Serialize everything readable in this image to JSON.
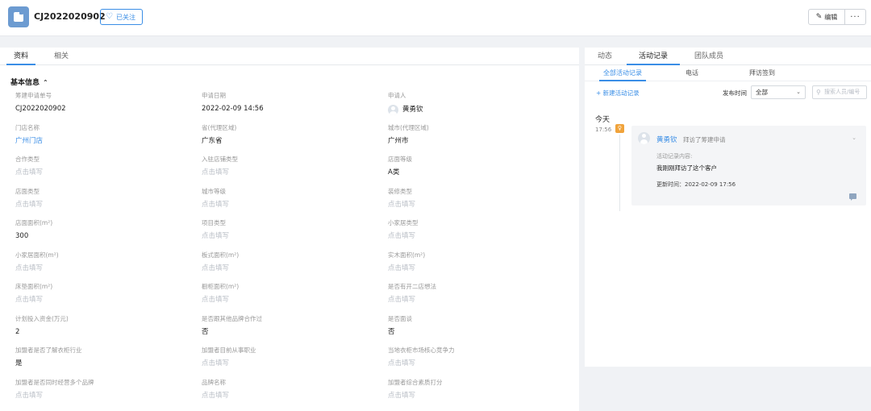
{
  "header": {
    "title": "CJ2022020902",
    "follow_label": "已关注",
    "edit_label": "编辑",
    "more_label": "···"
  },
  "left_tabs": [
    "资料",
    "相关"
  ],
  "section_title": "基本信息",
  "fields": [
    {
      "label": "筹建申请单号",
      "value": "CJ2022020902",
      "kind": "text"
    },
    {
      "label": "申请日期",
      "value": "2022-02-09 14:56",
      "kind": "text"
    },
    {
      "label": "申请人",
      "value": "黄勇钦",
      "kind": "user"
    },
    {
      "label": "门店名称",
      "value": "广州门店",
      "kind": "link"
    },
    {
      "label": "省(代理区域)",
      "value": "广东省",
      "kind": "text"
    },
    {
      "label": "城市(代理区域)",
      "value": "广州市",
      "kind": "text"
    },
    {
      "label": "合作类型",
      "value": "点击填写",
      "kind": "placeholder"
    },
    {
      "label": "入驻店铺类型",
      "value": "点击填写",
      "kind": "placeholder"
    },
    {
      "label": "店面等级",
      "value": "A类",
      "kind": "text"
    },
    {
      "label": "店面类型",
      "value": "点击填写",
      "kind": "placeholder"
    },
    {
      "label": "城市等级",
      "value": "点击填写",
      "kind": "placeholder"
    },
    {
      "label": "装修类型",
      "value": "点击填写",
      "kind": "placeholder"
    },
    {
      "label": "店面面积(m²)",
      "value": "300",
      "kind": "text"
    },
    {
      "label": "项目类型",
      "value": "点击填写",
      "kind": "placeholder"
    },
    {
      "label": "小家居类型",
      "value": "点击填写",
      "kind": "placeholder"
    },
    {
      "label": "小家居面积(m²)",
      "value": "点击填写",
      "kind": "placeholder"
    },
    {
      "label": "板式面积(m²)",
      "value": "点击填写",
      "kind": "placeholder"
    },
    {
      "label": "实木面积(m²)",
      "value": "点击填写",
      "kind": "placeholder"
    },
    {
      "label": "床垫面积(m²)",
      "value": "点击填写",
      "kind": "placeholder"
    },
    {
      "label": "橱柜面积(m²)",
      "value": "点击填写",
      "kind": "placeholder"
    },
    {
      "label": "是否有开二店想法",
      "value": "点击填写",
      "kind": "placeholder"
    },
    {
      "label": "计划投入资金(万元)",
      "value": "2",
      "kind": "text"
    },
    {
      "label": "是否跟其他品牌合作过",
      "value": "否",
      "kind": "text"
    },
    {
      "label": "是否面谈",
      "value": "否",
      "kind": "text"
    },
    {
      "label": "加盟者是否了解衣柜行业",
      "value": "是",
      "kind": "text"
    },
    {
      "label": "加盟者目前从事职业",
      "value": "点击填写",
      "kind": "placeholder"
    },
    {
      "label": "当地衣柜市场核心竞争力",
      "value": "点击填写",
      "kind": "placeholder"
    },
    {
      "label": "加盟者是否同时经营多个品牌",
      "value": "点击填写",
      "kind": "placeholder"
    },
    {
      "label": "品牌名称",
      "value": "点击填写",
      "kind": "placeholder"
    },
    {
      "label": "加盟者综合素质打分",
      "value": "点击填写",
      "kind": "placeholder"
    }
  ],
  "right_tabs": [
    "动态",
    "活动记录",
    "团队成员"
  ],
  "sub_tabs": [
    "全部活动记录",
    "电话",
    "拜访签到"
  ],
  "toolbar": {
    "new_label": "+ 新建活动记录",
    "publish_label": "发布时间",
    "select_value": "全部",
    "search_placeholder": "搜索人员/编号"
  },
  "timeline": {
    "day_label": "今天",
    "time": "17:56",
    "pin_glyph": "♀",
    "author": "黄勇钦",
    "action": "拜访了筹建申请",
    "content_label": "活动记录内容:",
    "content_text": "我刚刚拜访了这个客户",
    "updated_text": "更新时间：2022-02-09 17:56"
  },
  "colors": {
    "accent": "#3a8ee6",
    "pin": "#f0a33b",
    "placeholder": "#b9bec6"
  },
  "icons": [
    "logo-icon",
    "heart-icon",
    "pencil-icon",
    "more-icon",
    "chevron-up-icon",
    "chevron-down-icon",
    "search-icon",
    "comment-icon",
    "user-avatar-icon"
  ]
}
